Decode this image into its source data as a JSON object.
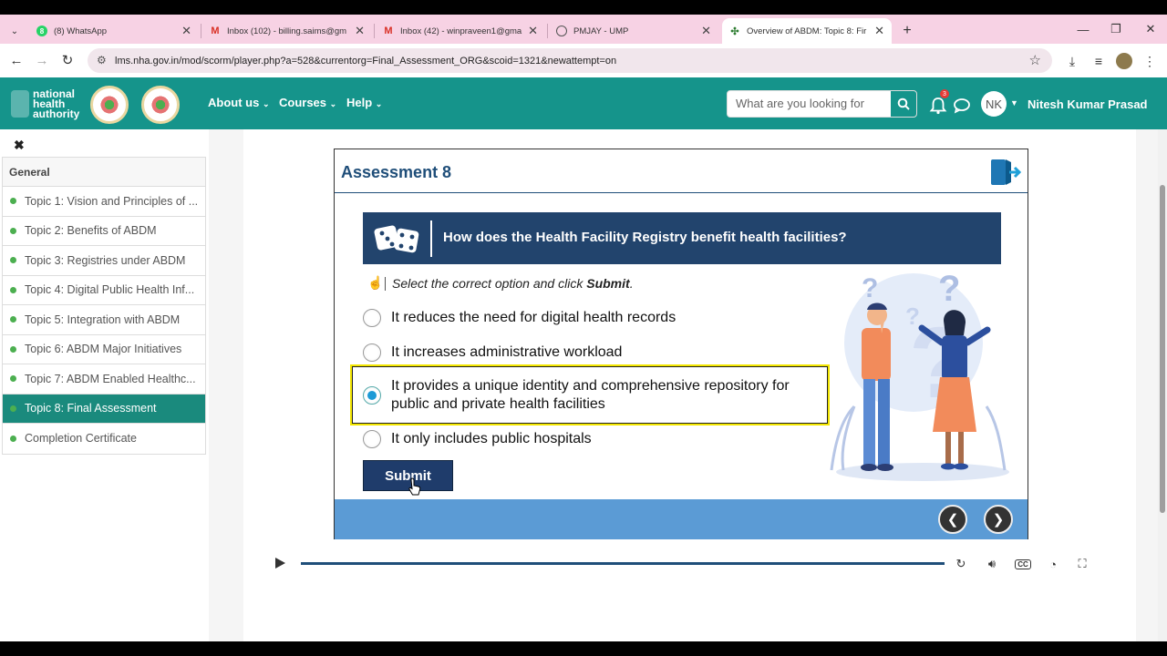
{
  "browser": {
    "tabs": [
      {
        "title": "(8) WhatsApp",
        "icon": "whatsapp-icon",
        "badge": "8"
      },
      {
        "title": "Inbox (102) - billing.saims@gm",
        "icon": "gmail-icon"
      },
      {
        "title": "Inbox (42) - winpraveen1@gma",
        "icon": "gmail-icon"
      },
      {
        "title": "PMJAY - UMP",
        "icon": "globe-icon"
      },
      {
        "title": "Overview of ABDM: Topic 8: Fir",
        "icon": "site-icon",
        "active": true
      }
    ],
    "url": "lms.nha.gov.in/mod/scorm/player.php?a=528&currentorg=Final_Assessment_ORG&scoid=1321&newattempt=on"
  },
  "header": {
    "logo_text": "national health authority",
    "menu": [
      "About us",
      "Courses",
      "Help"
    ],
    "search_placeholder": "What are you looking for",
    "notification_count": "3",
    "avatar_initials": "NK",
    "user_name": "Nitesh Kumar Prasad",
    "accent": "#15948b"
  },
  "sidebar": {
    "section": "General",
    "items": [
      {
        "label": "Topic 1: Vision and Principles of ..."
      },
      {
        "label": "Topic 2: Benefits of ABDM"
      },
      {
        "label": "Topic 3: Registries under ABDM"
      },
      {
        "label": "Topic 4: Digital Public Health Inf..."
      },
      {
        "label": "Topic 5: Integration with ABDM"
      },
      {
        "label": "Topic 6: ABDM Major Initiatives"
      },
      {
        "label": "Topic 7: ABDM Enabled Healthc..."
      },
      {
        "label": "Topic 8: Final Assessment",
        "active": true
      },
      {
        "label": "Completion Certificate"
      }
    ]
  },
  "slide": {
    "title": "Assessment 8",
    "question": "How does the Health Facility Registry benefit health facilities?",
    "instruction_pre": "Select the correct option and click ",
    "instruction_bold": "Submit",
    "instruction_post": ".",
    "options": [
      {
        "text": "It reduces the need for digital health records",
        "selected": false
      },
      {
        "text": "It increases administrative workload",
        "selected": false
      },
      {
        "text": "It provides a unique identity and comprehensive repository for public and private health facilities",
        "selected": true
      },
      {
        "text": "It only includes public hospitals",
        "selected": false
      }
    ],
    "submit_label": "Submit",
    "prev_glyph": "❮",
    "next_glyph": "❯"
  }
}
